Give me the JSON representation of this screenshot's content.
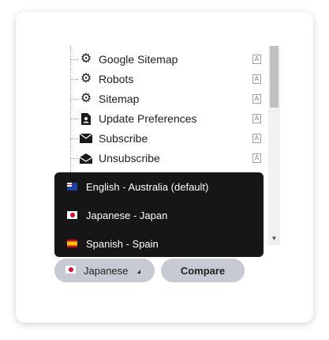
{
  "tree": {
    "items": [
      {
        "label": "Google Sitemap",
        "icon": "gear-icon"
      },
      {
        "label": "Robots",
        "icon": "gear-icon"
      },
      {
        "label": "Sitemap",
        "icon": "gear-icon"
      },
      {
        "label": "Update Preferences",
        "icon": "document-person-icon"
      },
      {
        "label": "Subscribe",
        "icon": "envelope-icon"
      },
      {
        "label": "Unsubscribe",
        "icon": "envelope-open-icon"
      }
    ],
    "translate_icon_text": "A"
  },
  "language_menu": {
    "options": [
      {
        "label": "English - Australia (default)",
        "flag": "flag-australia-icon"
      },
      {
        "label": "Japanese - Japan",
        "flag": "flag-japan-icon"
      },
      {
        "label": "Spanish - Spain",
        "flag": "flag-spain-icon"
      }
    ]
  },
  "toolbar": {
    "language_label": "Japanese",
    "language_flag": "flag-japan-icon",
    "compare_label": "Compare"
  },
  "colors": {
    "dropdown_bg": "#161616",
    "button_bg": "#c8cad3"
  }
}
